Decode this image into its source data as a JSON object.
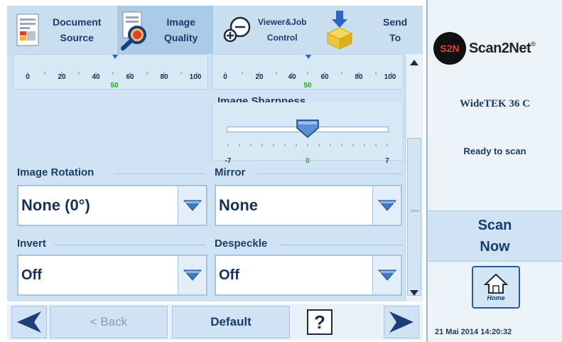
{
  "tabs": [
    {
      "line1": "Document",
      "line2": "Source",
      "icon": "document-icon",
      "active": false
    },
    {
      "line1": "Image",
      "line2": "Quality",
      "icon": "magnifier-icon",
      "active": true
    },
    {
      "line1": "Viewer&Job",
      "line2": "Control",
      "icon": "zoom-icon",
      "active": false
    },
    {
      "line1": "Send",
      "line2": "To",
      "icon": "send-box-icon",
      "active": false
    }
  ],
  "sliders_top": [
    {
      "ticks": [
        "0",
        "20",
        "40",
        "60",
        "80",
        "100"
      ],
      "value": "50"
    },
    {
      "ticks": [
        "0",
        "20",
        "40",
        "60",
        "80",
        "100"
      ],
      "value": "50"
    }
  ],
  "sharpness": {
    "label": "Image Sharpness",
    "min": "-7",
    "max": "7",
    "value": "0"
  },
  "fields": {
    "rotation": {
      "label": "Image Rotation",
      "value": "None (0°)"
    },
    "mirror": {
      "label": "Mirror",
      "value": "None"
    },
    "invert": {
      "label": "Invert",
      "value": "Off"
    },
    "despeckle": {
      "label": "Despeckle",
      "value": "Off"
    }
  },
  "bottom": {
    "back": "< Back",
    "default": "Default",
    "help": "?"
  },
  "right": {
    "logo_mark": "S2N",
    "logo_text": "Scan2Net",
    "logo_reg": "®",
    "model": "WideTEK 36 C",
    "status": "Ready to scan",
    "scan_line1": "Scan",
    "scan_line2": "Now",
    "home": "Home",
    "datetime": "21 Mai 2014 14:20:32"
  },
  "colors": {
    "accent": "#1b3b6e",
    "panel": "#cfe3f4",
    "dropdown_arrow": "#3d7ac8"
  }
}
